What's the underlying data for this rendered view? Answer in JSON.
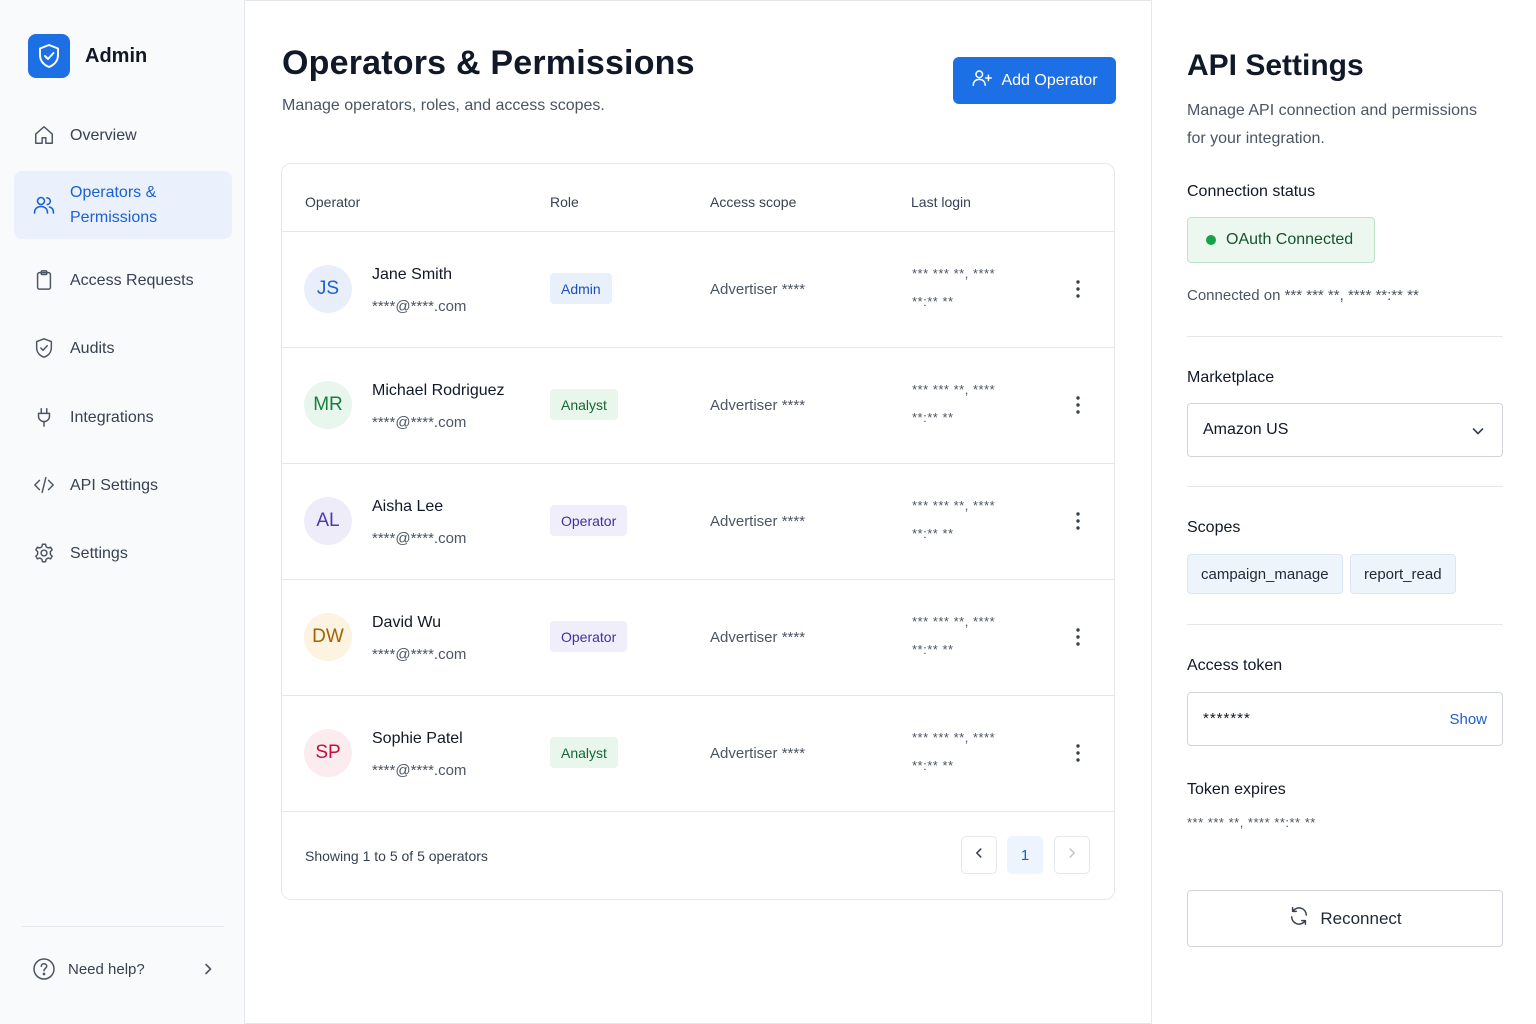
{
  "brand": {
    "name": "Admin"
  },
  "sidebar": {
    "items": [
      {
        "label": "Overview",
        "icon": "home-icon"
      },
      {
        "label": "Operators &\nPermissions",
        "icon": "users-icon",
        "active": true
      },
      {
        "label": "Access Requests",
        "icon": "clipboard-icon"
      },
      {
        "label": "Audits",
        "icon": "shield-check-icon"
      },
      {
        "label": "Integrations",
        "icon": "plug-icon"
      },
      {
        "label": "API Settings",
        "icon": "code-icon"
      },
      {
        "label": "Settings",
        "icon": "gear-icon"
      }
    ],
    "help_label": "Need help?"
  },
  "main": {
    "title": "Operators & Permissions",
    "subtitle": "Manage operators, roles, and access scopes.",
    "add_button_label": "Add Operator",
    "table": {
      "columns": [
        "Operator",
        "Role",
        "Access scope",
        "Last login"
      ],
      "rows": [
        {
          "initials": "JS",
          "name": "Jane Smith",
          "email": "****@****.com",
          "role": "Admin",
          "scope": "Advertiser ****",
          "login_line1": "*** *** **, ****",
          "login_line2": "**:** **"
        },
        {
          "initials": "MR",
          "name": "Michael Rodriguez",
          "email": "****@****.com",
          "role": "Analyst",
          "scope": "Advertiser ****",
          "login_line1": "*** *** **, ****",
          "login_line2": "**:** **"
        },
        {
          "initials": "AL",
          "name": "Aisha Lee",
          "email": "****@****.com",
          "role": "Operator",
          "scope": "Advertiser ****",
          "login_line1": "*** *** **, ****",
          "login_line2": "**:** **"
        },
        {
          "initials": "DW",
          "name": "David Wu",
          "email": "****@****.com",
          "role": "Operator",
          "scope": "Advertiser ****",
          "login_line1": "*** *** **, ****",
          "login_line2": "**:** **"
        },
        {
          "initials": "SP",
          "name": "Sophie Patel",
          "email": "****@****.com",
          "role": "Analyst",
          "scope": "Advertiser ****",
          "login_line1": "*** *** **, ****",
          "login_line2": "**:** **"
        }
      ]
    },
    "pagination": {
      "summary": "Showing 1 to 5 of 5 operators",
      "current_page": "1"
    }
  },
  "api_panel": {
    "title": "API Settings",
    "description": "Manage API connection and permissions for your integration.",
    "connection_status_label": "Connection status",
    "status_text": "OAuth Connected",
    "connected_on": "Connected on *** *** **, **** **:** **",
    "marketplace_label": "Marketplace",
    "marketplace_value": "Amazon US",
    "scopes_label": "Scopes",
    "scopes": [
      "campaign_manage",
      "report_read"
    ],
    "access_token_label": "Access token",
    "access_token_value": "*******",
    "show_label": "Show",
    "token_expires_label": "Token expires",
    "token_expires_value": "*** *** **, **** **:** **",
    "reconnect_label": "Reconnect"
  },
  "colors": {
    "accent": "#1d6fe6",
    "status_green": "#16a34a",
    "avatar_js": "#e8effb",
    "avatar_mr": "#e9f6ee",
    "avatar_al": "#efecfa",
    "avatar_dw": "#fcf3e0",
    "avatar_sp": "#fdecef"
  }
}
